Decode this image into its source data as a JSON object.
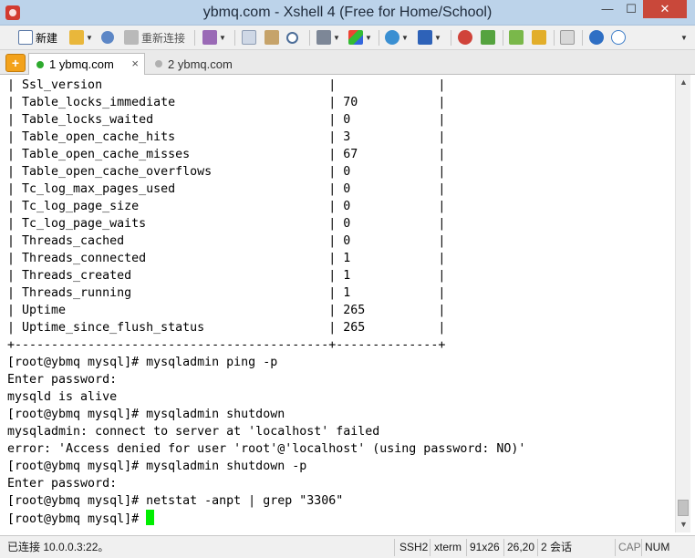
{
  "window": {
    "title": "ybmq.com - Xshell 4 (Free for Home/School)",
    "min_glyph": "—",
    "max_glyph": "☐",
    "close_glyph": "✕"
  },
  "toolbar": {
    "new_label": "新建",
    "reconnect_label": "重新连接"
  },
  "tabs": [
    {
      "label": "1 ybmq.com",
      "status_color": "#2eaa2e",
      "close_glyph": "×"
    },
    {
      "label": "2 ybmq.com",
      "status_color": "#b0b0b0"
    }
  ],
  "terminal": {
    "lines": [
      "| Ssl_version                               |              |",
      "| Table_locks_immediate                     | 70           |",
      "| Table_locks_waited                        | 0            |",
      "| Table_open_cache_hits                     | 3            |",
      "| Table_open_cache_misses                   | 67           |",
      "| Table_open_cache_overflows                | 0            |",
      "| Tc_log_max_pages_used                     | 0            |",
      "| Tc_log_page_size                          | 0            |",
      "| Tc_log_page_waits                         | 0            |",
      "| Threads_cached                            | 0            |",
      "| Threads_connected                         | 1            |",
      "| Threads_created                           | 1            |",
      "| Threads_running                           | 1            |",
      "| Uptime                                    | 265          |",
      "| Uptime_since_flush_status                 | 265          |",
      "+-------------------------------------------+--------------+",
      "[root@ybmq mysql]# mysqladmin ping -p",
      "Enter password:",
      "mysqld is alive",
      "[root@ybmq mysql]# mysqladmin shutdown",
      "mysqladmin: connect to server at 'localhost' failed",
      "error: 'Access denied for user 'root'@'localhost' (using password: NO)'",
      "[root@ybmq mysql]# mysqladmin shutdown -p",
      "Enter password:",
      "[root@ybmq mysql]# netstat -anpt | grep \"3306\""
    ],
    "prompt": "[root@ybmq mysql]# ",
    "cursor_color": "#00ee00"
  },
  "statusbar": {
    "connection": "已连接 10.0.0.3:22。",
    "protocol": "SSH2",
    "terminal_type": "xterm",
    "size": "91x26",
    "position": "26,20",
    "sessions": "2 会话",
    "caps": "CAP",
    "num": "NUM"
  },
  "icons": [
    "app-icon",
    "new-session-icon",
    "open-folder-icon",
    "link-icon",
    "reconnect-icon",
    "properties-icon",
    "copy-icon",
    "paste-icon",
    "find-icon",
    "print-icon",
    "color-scheme-icon",
    "globe-icon",
    "font-icon",
    "xftp-icon",
    "xmanager-icon",
    "fullscreen-icon",
    "lock-icon",
    "keyboard-icon",
    "help-icon",
    "chat-icon"
  ]
}
